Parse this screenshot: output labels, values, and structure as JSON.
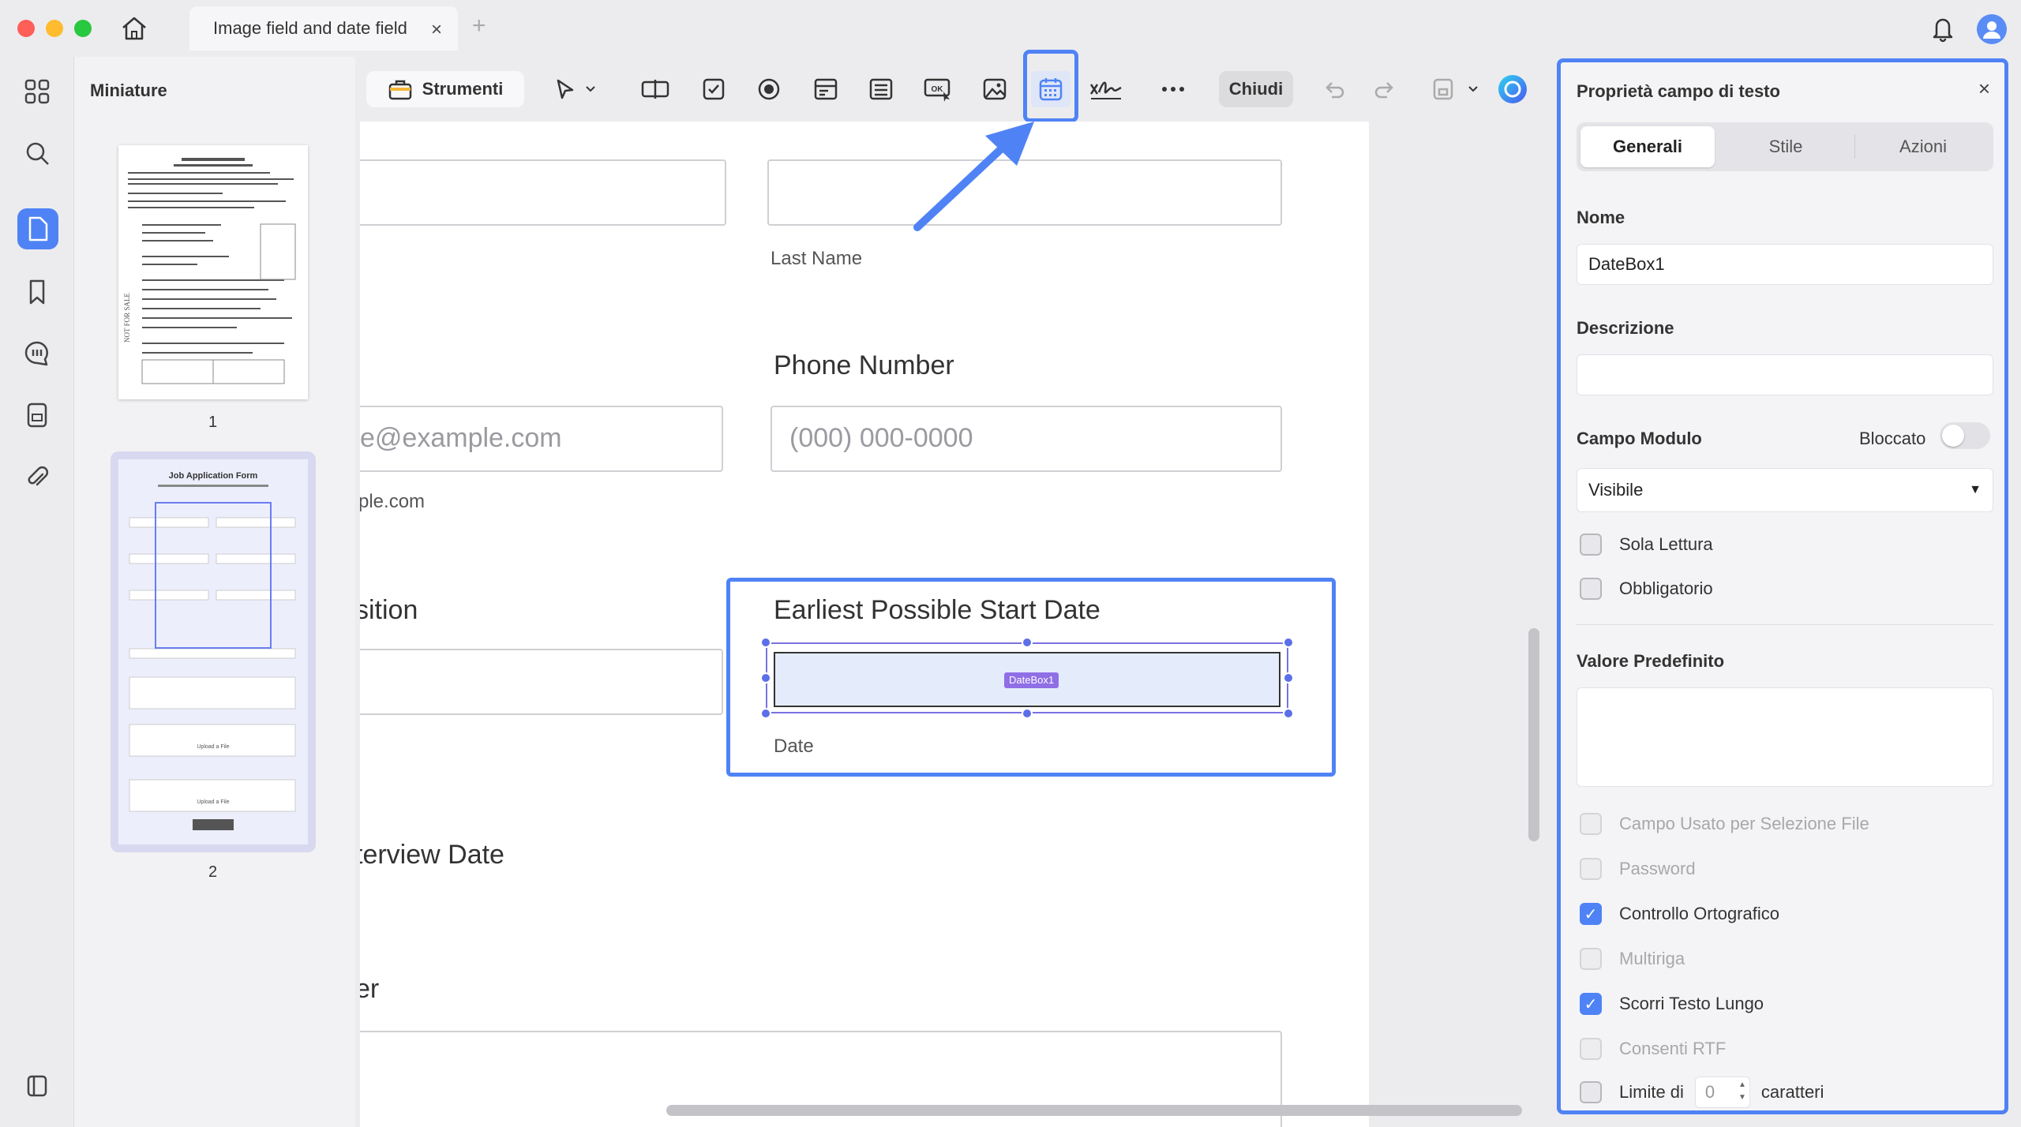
{
  "titlebar": {
    "tab_title": "Image field and date field",
    "tab_close": "×",
    "tab_add": "+"
  },
  "thumbnails": {
    "title": "Miniature",
    "pages": [
      {
        "number": "1"
      },
      {
        "number": "2"
      }
    ],
    "page1_heading": "ROAD TRAFFIC LAW, CAP. 166",
    "page2_heading": "Job Application Form"
  },
  "toolbar": {
    "strumenti_label": "Strumenti",
    "chiudi_label": "Chiudi"
  },
  "document": {
    "last_name_label": "Last Name",
    "phone_heading": "Phone Number",
    "phone_placeholder": "(000) 000-0000",
    "email_placeholder_partial": "e@example.com",
    "email_hint_partial": "ple.com",
    "position_heading_partial": "sition",
    "start_date_heading": "Earliest Possible Start Date",
    "date_label": "Date",
    "datebox_tag": "DateBox1",
    "interview_heading_partial": "terview Date",
    "bottom_heading_partial": "er"
  },
  "properties": {
    "title": "Proprietà campo di testo",
    "close": "×",
    "tabs": [
      {
        "label": "Generali",
        "active": true
      },
      {
        "label": "Stile",
        "active": false
      },
      {
        "label": "Azioni",
        "active": false
      }
    ],
    "name_label": "Nome",
    "name_value": "DateBox1",
    "description_label": "Descrizione",
    "description_value": "",
    "form_field_label": "Campo Modulo",
    "locked_label": "Bloccato",
    "locked": false,
    "visibility_value": "Visibile",
    "read_only_label": "Sola Lettura",
    "required_label": "Obbligatorio",
    "default_value_label": "Valore Predefinito",
    "default_value": "",
    "options": [
      {
        "label": "Campo Usato per Selezione File",
        "checked": false,
        "disabled": true
      },
      {
        "label": "Password",
        "checked": false,
        "disabled": true
      },
      {
        "label": "Controllo Ortografico",
        "checked": true,
        "disabled": false
      },
      {
        "label": "Multiriga",
        "checked": false,
        "disabled": true
      },
      {
        "label": "Scorri Testo Lungo",
        "checked": true,
        "disabled": false
      },
      {
        "label": "Consenti RTF",
        "checked": false,
        "disabled": true
      }
    ],
    "limit_prefix": "Limite di",
    "limit_value": "0",
    "limit_suffix": "caratteri"
  },
  "colors": {
    "accent": "#4f83f5",
    "field_tag": "#8f6ee6"
  }
}
